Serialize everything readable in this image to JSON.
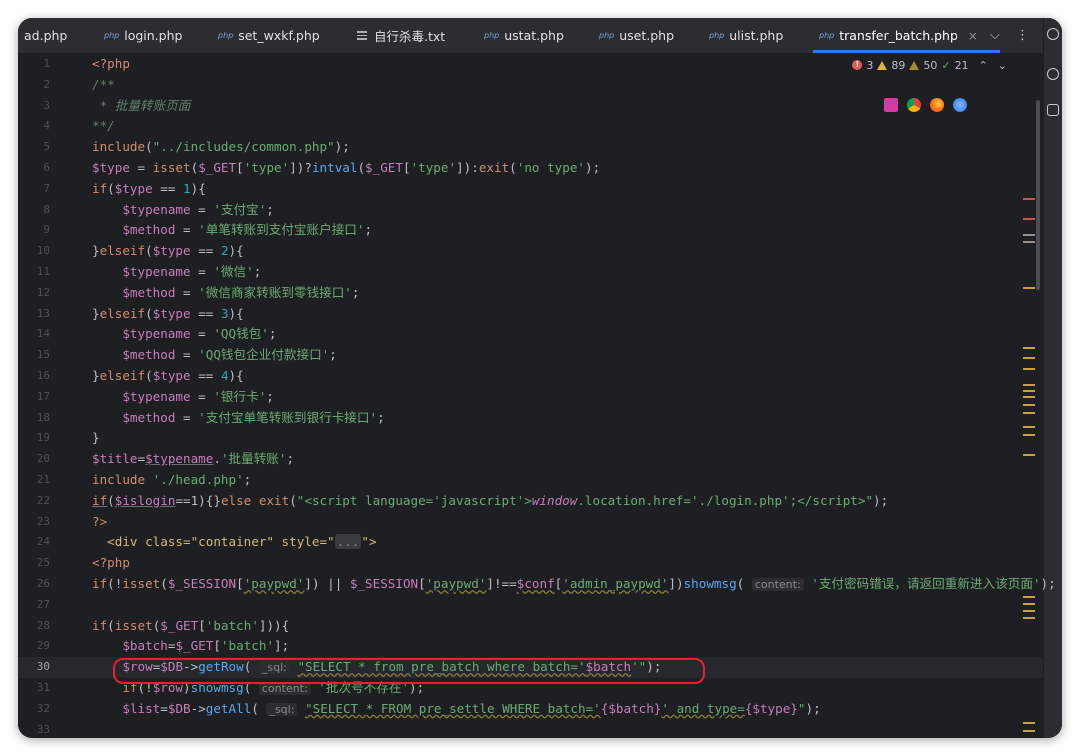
{
  "tabs": [
    {
      "label": "ad.php",
      "type": "php"
    },
    {
      "label": "login.php",
      "type": "php"
    },
    {
      "label": "set_wxkf.php",
      "type": "php"
    },
    {
      "label": "自行杀毒.txt",
      "type": "text"
    },
    {
      "label": "ustat.php",
      "type": "php"
    },
    {
      "label": "uset.php",
      "type": "php"
    },
    {
      "label": "ulist.php",
      "type": "php"
    },
    {
      "label": "transfer_batch.php",
      "type": "php",
      "active": true
    }
  ],
  "tab_badge": "php",
  "tab_close": "×",
  "tab_controls": {
    "dropdown": "⌵",
    "more": "⋮"
  },
  "inspections": {
    "errors": "3",
    "warnings": "89",
    "weak_warnings": "50",
    "typos": "21",
    "up": "⌃",
    "down": "⌄"
  },
  "line_numbers": [
    "1",
    "2",
    "3",
    "4",
    "5",
    "6",
    "7",
    "8",
    "9",
    "10",
    "11",
    "12",
    "13",
    "14",
    "15",
    "16",
    "17",
    "18",
    "19",
    "20",
    "21",
    "22",
    "23",
    "24",
    "25",
    "26",
    "27",
    "28",
    "29",
    "30",
    "31",
    "32",
    "33"
  ],
  "current_line": "30",
  "code": {
    "l1": "<?php",
    "l2": "/**",
    "l3": " * 批量转账页面",
    "l4": "**/",
    "l5_fn": "include",
    "l5_str": "\"../includes/common.php\"",
    "l6": {
      "v1": "$type",
      "f1": "isset",
      "v2": "$_GET",
      "s1": "'type'",
      "f2": "intval",
      "s2": "'type'",
      "f3": "exit",
      "s3": "'no type'"
    },
    "l7_num": "1",
    "l8_s": "'支付宝'",
    "l9_s": "'单笔转账到支付宝账户接口'",
    "l10_num": "2",
    "l11_s": "'微信'",
    "l12_s": "'微信商家转账到零钱接口'",
    "l13_num": "3",
    "l14_s": "'QQ钱包'",
    "l15_s": "'QQ钱包企业付款接口'",
    "l16_num": "4",
    "l17_s": "'银行卡'",
    "l18_s": "'支付宝单笔转账到银行卡接口'",
    "l20_s": "'批量转账'",
    "l21_s": "'./head.php'",
    "l22_s1": "\"<script language='javascript'>",
    "l22_js": "window",
    "l22_s2": ".location.href='./login.php';</script>\"",
    "l24_tag": "<div class=\"container\" style=\"",
    "l24_fold": "...",
    "l24_end": "\">",
    "l26": {
      "sess": "$_SESSION",
      "k1": "'paypwd'",
      "k2": "'paypwd'",
      "conf": "$conf",
      "k3": "'admin_paypwd'",
      "fn": "showmsg",
      "hint": "content:",
      "msg": "'支付密码错误，请返回重新进入该页面'"
    },
    "l28_k": "'batch'",
    "l29_k": "'batch'",
    "l30": {
      "hint": "_sql:",
      "q1": "\"SELECT * from pre_batch where batch='",
      "q2": "$batch",
      "q3": "'\""
    },
    "l31": {
      "hint": "content:",
      "msg": "'批次号不存在'"
    },
    "l32": {
      "hint": "_sql:",
      "q1": "\"SELECT * FROM pre_settle WHERE batch='",
      "q2": "{$batch}",
      "q3": "' and type=",
      "q4": "{$type}",
      "q5": "\""
    }
  },
  "colors": {
    "accent": "#3574f0",
    "highlight": "#e5212c",
    "error": "#e55b5b",
    "warning": "#e2b440"
  }
}
